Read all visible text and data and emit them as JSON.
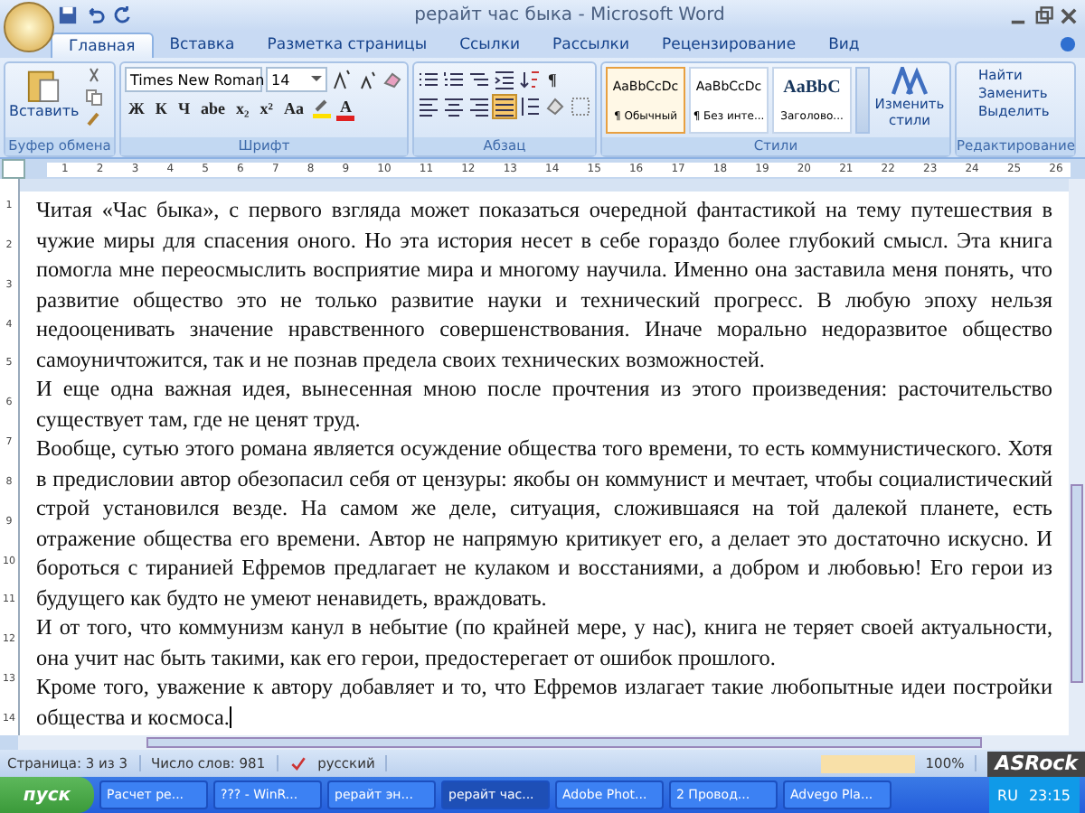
{
  "window": {
    "title": "рерайт час быка - Microsoft Word"
  },
  "tabs": [
    {
      "label": "Главная",
      "selected": true
    },
    {
      "label": "Вставка",
      "selected": false
    },
    {
      "label": "Разметка страницы",
      "selected": false
    },
    {
      "label": "Ссылки",
      "selected": false
    },
    {
      "label": "Рассылки",
      "selected": false
    },
    {
      "label": "Рецензирование",
      "selected": false
    },
    {
      "label": "Вид",
      "selected": false
    }
  ],
  "ribbon": {
    "clipboard": {
      "label": "Буфер обмена",
      "paste": "Вставить"
    },
    "font": {
      "label": "Шрифт",
      "family": "Times New Roman",
      "size": "14",
      "format_buttons": [
        "Ж",
        "К",
        "Ч",
        "abe",
        "x₂",
        "x²",
        "Aa"
      ],
      "color_button": "A"
    },
    "paragraph": {
      "label": "Абзац",
      "pilcrow": "¶"
    },
    "styles": {
      "label": "Стили",
      "items": [
        {
          "sample": "AaBbCcDc",
          "name": "¶ Обычный",
          "selected": true
        },
        {
          "sample": "AaBbCcDc",
          "name": "¶ Без инте...",
          "selected": false
        },
        {
          "sample": "AaBbC",
          "name": "Заголово...",
          "selected": false
        }
      ],
      "change": "Изменить стили"
    },
    "editing": {
      "label": "Редактирование",
      "items": [
        "Найти",
        "Заменить",
        "Выделить"
      ]
    }
  },
  "ruler": {
    "numbers": [
      "1",
      "2",
      "3",
      "4",
      "5",
      "6",
      "7",
      "8",
      "9",
      "10",
      "11",
      "12",
      "13",
      "14",
      "15",
      "16",
      "17",
      "18",
      "19",
      "20",
      "21",
      "22",
      "23",
      "24",
      "25",
      "26"
    ],
    "vertical_numbers": [
      "1",
      "2",
      "3",
      "4",
      "5",
      "6",
      "7",
      "8",
      "9",
      "10",
      "11",
      "12",
      "13",
      "14"
    ]
  },
  "document": {
    "paragraphs": [
      "Читая «Час быка», с первого взгляда может показаться очередной фантастикой на тему путешествия в чужие миры для спасения оного. Но эта история несет в себе гораздо более глубокий смысл. Эта книга помогла мне переосмыслить восприятие мира и многому научила. Именно она заставила меня понять, что  развитие общество это не только развитие науки и технический прогресс. В любую эпоху нельзя  недооценивать значение нравственного совершенствования. Иначе морально недоразвитое общество самоуничтожится, так и не познав предела своих технических возможностей.",
      "И еще одна важная идея, вынесенная мною после прочтения из этого произведения: расточительство существует там, где не ценят труд.",
      "Вообще, сутью этого романа является осуждение общества того времени, то есть коммунистического. Хотя в предисловии автор обезопасил себя от цензуры: якобы он коммунист и мечтает, чтобы социалистический строй установился везде. На самом же деле, ситуация, сложившаяся на той далекой планете, есть отражение общества его времени. Автор не напрямую критикует его, а делает это достаточно искусно. И бороться с тиранией Ефремов предлагает не кулаком и восстаниями, а добром и любовью! Его герои из будущего как будто не умеют ненавидеть, враждовать.",
      "И от того, что коммунизм канул в небытие (по крайней мере, у нас), книга не теряет своей актуальности, она учит нас быть такими, как его герои, предостерегает от ошибок прошлого.",
      "Кроме того, уважение к автору добавляет и то, что Ефремов излагает такие любопытные идеи постройки общества и космоса."
    ]
  },
  "status_bar": {
    "page": "Страница: 3 из 3",
    "words": "Число слов: 981",
    "language": "русский",
    "zoom": "100%",
    "overlay": "ASRock"
  },
  "taskbar": {
    "start": "пуск",
    "items": [
      {
        "label": "Расчет ре...",
        "selected": false
      },
      {
        "label": "??? - WinR...",
        "selected": false
      },
      {
        "label": "рерайт эн...",
        "selected": false
      },
      {
        "label": "рерайт час...",
        "selected": true
      },
      {
        "label": "Adobe Phot...",
        "selected": false
      },
      {
        "label": "2 Провод...",
        "selected": false
      },
      {
        "label": "Advego Pla...",
        "selected": false
      }
    ],
    "language": "RU",
    "time": "23:15"
  }
}
